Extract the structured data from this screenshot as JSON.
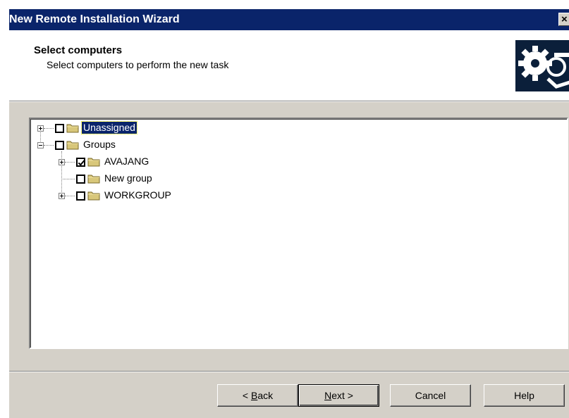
{
  "window": {
    "title": "New Remote Installation Wizard",
    "close_glyph": "×"
  },
  "header": {
    "title": "Select computers",
    "subtitle": "Select computers to perform the new task",
    "icon": "wizard-gears-icon"
  },
  "tree": {
    "nodes": [
      {
        "label": "Unassigned",
        "checked": false,
        "expander": "plus",
        "selected": true
      },
      {
        "label": "Groups",
        "checked": false,
        "expander": "minus",
        "selected": false
      },
      {
        "label": "AVAJANG",
        "checked": true,
        "expander": "plus",
        "selected": false
      },
      {
        "label": "New group",
        "checked": false,
        "expander": "none",
        "selected": false
      },
      {
        "label": "WORKGROUP",
        "checked": false,
        "expander": "plus",
        "selected": false
      }
    ]
  },
  "buttons": {
    "back_prefix": "< ",
    "back_accel": "B",
    "back_rest": "ack",
    "next_accel": "N",
    "next_rest": "ext >",
    "cancel": "Cancel",
    "help": "Help"
  },
  "colors": {
    "titlebar": "#0a246a",
    "dialog_face": "#d4d0c8",
    "selection": "#0a246a"
  }
}
